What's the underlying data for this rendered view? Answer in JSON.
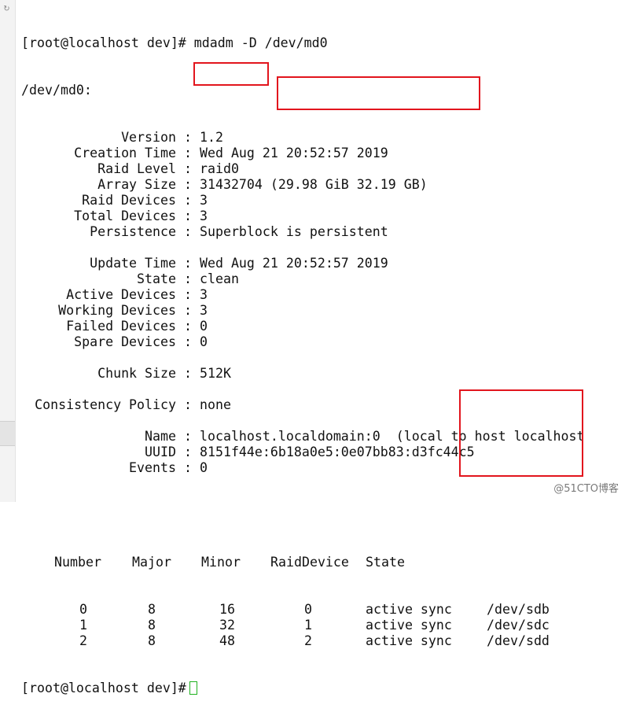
{
  "terminal": {
    "command_line": "[root@localhost dev]# mdadm -D /dev/md0",
    "device_path": "/dev/md0:",
    "info": [
      {
        "label": "Version",
        "value": "1.2"
      },
      {
        "label": "Creation Time",
        "value": "Wed Aug 21 20:52:57 2019"
      },
      {
        "label": "Raid Level",
        "value": "raid0"
      },
      {
        "label": "Array Size",
        "value": "31432704 (29.98 GiB 32.19 GB)"
      },
      {
        "label": "Raid Devices",
        "value": "3"
      },
      {
        "label": "Total Devices",
        "value": "3"
      },
      {
        "label": "Persistence",
        "value": "Superblock is persistent"
      },
      {
        "label": "",
        "value": ""
      },
      {
        "label": "Update Time",
        "value": "Wed Aug 21 20:52:57 2019"
      },
      {
        "label": "State",
        "value": "clean"
      },
      {
        "label": "Active Devices",
        "value": "3"
      },
      {
        "label": "Working Devices",
        "value": "3"
      },
      {
        "label": "Failed Devices",
        "value": "0"
      },
      {
        "label": "Spare Devices",
        "value": "0"
      },
      {
        "label": "",
        "value": ""
      },
      {
        "label": "Chunk Size",
        "value": "512K"
      },
      {
        "label": "",
        "value": ""
      },
      {
        "label": "Consistency Policy",
        "value": "none"
      },
      {
        "label": "",
        "value": ""
      },
      {
        "label": "Name",
        "value": "localhost.localdomain:0  (local to host localhost"
      },
      {
        "label": "UUID",
        "value": "8151f44e:6b18a0e5:0e07bb83:d3fc44c5"
      },
      {
        "label": "Events",
        "value": "0"
      }
    ],
    "table_header": [
      "Number",
      "Major",
      "Minor",
      "RaidDevice",
      "State"
    ],
    "table_rows": [
      [
        "0",
        "8",
        "16",
        "0",
        "active sync",
        "/dev/sdb"
      ],
      [
        "1",
        "8",
        "32",
        "1",
        "active sync",
        "/dev/sdc"
      ],
      [
        "2",
        "8",
        "48",
        "2",
        "active sync",
        "/dev/sdd"
      ]
    ],
    "prompt": "[root@localhost dev]#"
  },
  "gutter": {
    "icon": "refresh-icon",
    "glyph": "↻"
  },
  "watermark": "@51CTO博客",
  "colors": {
    "highlight_box": "#e2151d",
    "cursor": "#1fb11f",
    "text": "#111111",
    "background": "#ffffff"
  }
}
